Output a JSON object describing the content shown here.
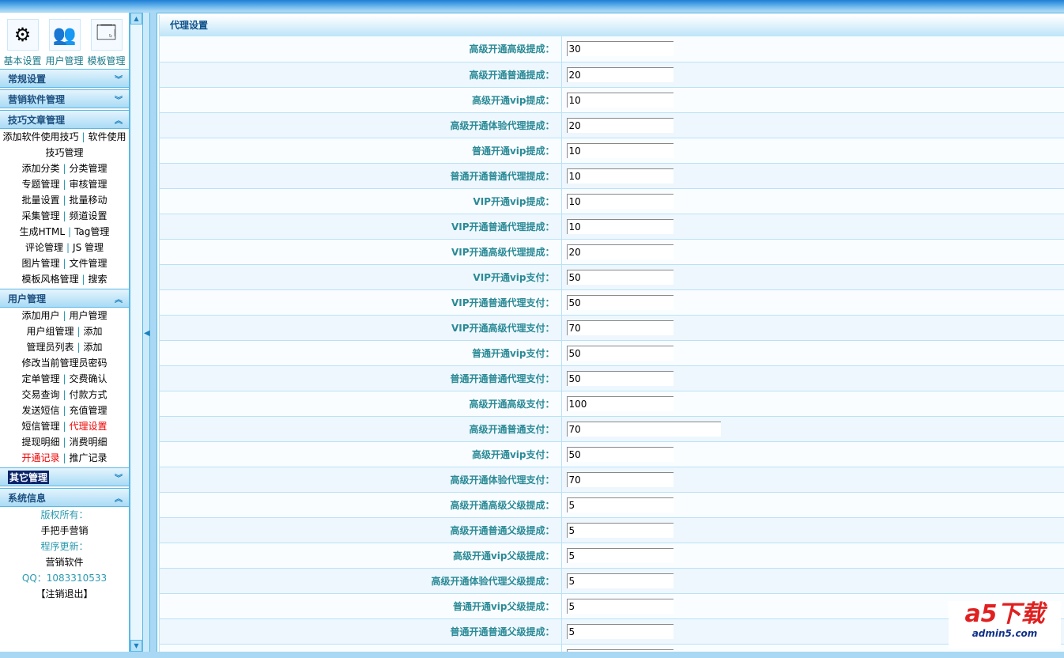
{
  "sidebar": {
    "top_icons": [
      {
        "label": "基本设置",
        "icon": "gears-icon"
      },
      {
        "label": "用户管理",
        "icon": "users-icon"
      },
      {
        "label": "模板管理",
        "icon": "template-icon"
      }
    ],
    "sections": [
      {
        "title": "常规设置",
        "expanded": false
      },
      {
        "title": "营销软件管理",
        "expanded": false
      },
      {
        "title": "技巧文章管理",
        "expanded": true,
        "rows": [
          [
            "添加软件使用技巧",
            "软件使用技巧管理"
          ],
          [
            "添加分类",
            "分类管理"
          ],
          [
            "专题管理",
            "审核管理"
          ],
          [
            "批量设置",
            "批量移动"
          ],
          [
            "采集管理",
            "频道设置"
          ],
          [
            "生成HTML",
            "Tag管理"
          ],
          [
            "评论管理",
            "JS 管理"
          ],
          [
            "图片管理",
            "文件管理"
          ],
          [
            "模板风格管理",
            "搜索"
          ]
        ]
      },
      {
        "title": "用户管理",
        "expanded": true,
        "rows": [
          [
            "添加用户",
            "用户管理"
          ],
          [
            "用户组管理",
            "添加"
          ],
          [
            "管理员列表",
            "添加"
          ],
          [
            "修改当前管理员密码"
          ],
          [
            "定单管理",
            "交费确认"
          ],
          [
            "交易查询",
            "付款方式"
          ],
          [
            "发送短信",
            "充值管理"
          ],
          [
            "短信管理",
            "代理设置"
          ],
          [
            "提现明细",
            "消费明细"
          ],
          [
            "开通记录",
            "推广记录"
          ]
        ]
      },
      {
        "title": "其它管理",
        "expanded": false
      },
      {
        "title": "系统信息",
        "expanded": true
      }
    ],
    "system_info": {
      "copyright_label": "版权所有：",
      "copyright_value": "手把手营销",
      "update_label": "程序更新：",
      "update_value": "营销软件",
      "qq": "QQ：1083310533",
      "logout": "【注销退出】"
    }
  },
  "main": {
    "title": "代理设置",
    "fields": [
      {
        "label": "高级开通高级提成：",
        "value": "30"
      },
      {
        "label": "高级开通普通提成：",
        "value": "20"
      },
      {
        "label": "高级开通vip提成：",
        "value": "10"
      },
      {
        "label": "高级开通体验代理提成：",
        "value": "20"
      },
      {
        "label": "普通开通vip提成：",
        "value": "10"
      },
      {
        "label": "普通开通普通代理提成：",
        "value": "10"
      },
      {
        "label": "VIP开通vip提成：",
        "value": "10"
      },
      {
        "label": "VIP开通普通代理提成：",
        "value": "10"
      },
      {
        "label": "VIP开通高级代理提成：",
        "value": "20"
      },
      {
        "label": "VIP开通vip支付：",
        "value": "50"
      },
      {
        "label": "VIP开通普通代理支付：",
        "value": "50"
      },
      {
        "label": "VIP开通高级代理支付：",
        "value": "70"
      },
      {
        "label": "普通开通vip支付：",
        "value": "50"
      },
      {
        "label": "普通开通普通代理支付：",
        "value": "50"
      },
      {
        "label": "高级开通高级支付：",
        "value": "100"
      },
      {
        "label": "高级开通普通支付：",
        "value": "70"
      },
      {
        "label": "高级开通vip支付：",
        "value": "50"
      },
      {
        "label": "高级开通体验代理支付：",
        "value": "70"
      },
      {
        "label": "高级开通高级父级提成：",
        "value": "5"
      },
      {
        "label": "高级开通普通父级提成：",
        "value": "5"
      },
      {
        "label": "高级开通vip父级提成：",
        "value": "5"
      },
      {
        "label": "高级开通体验代理父级提成：",
        "value": "5"
      },
      {
        "label": "普通开通vip父级提成：",
        "value": "5"
      },
      {
        "label": "普通开通普通父级提成：",
        "value": "5"
      },
      {
        "label": "",
        "value": ""
      }
    ]
  },
  "watermark": {
    "brand": "a5下载",
    "site": "admin5.com"
  }
}
